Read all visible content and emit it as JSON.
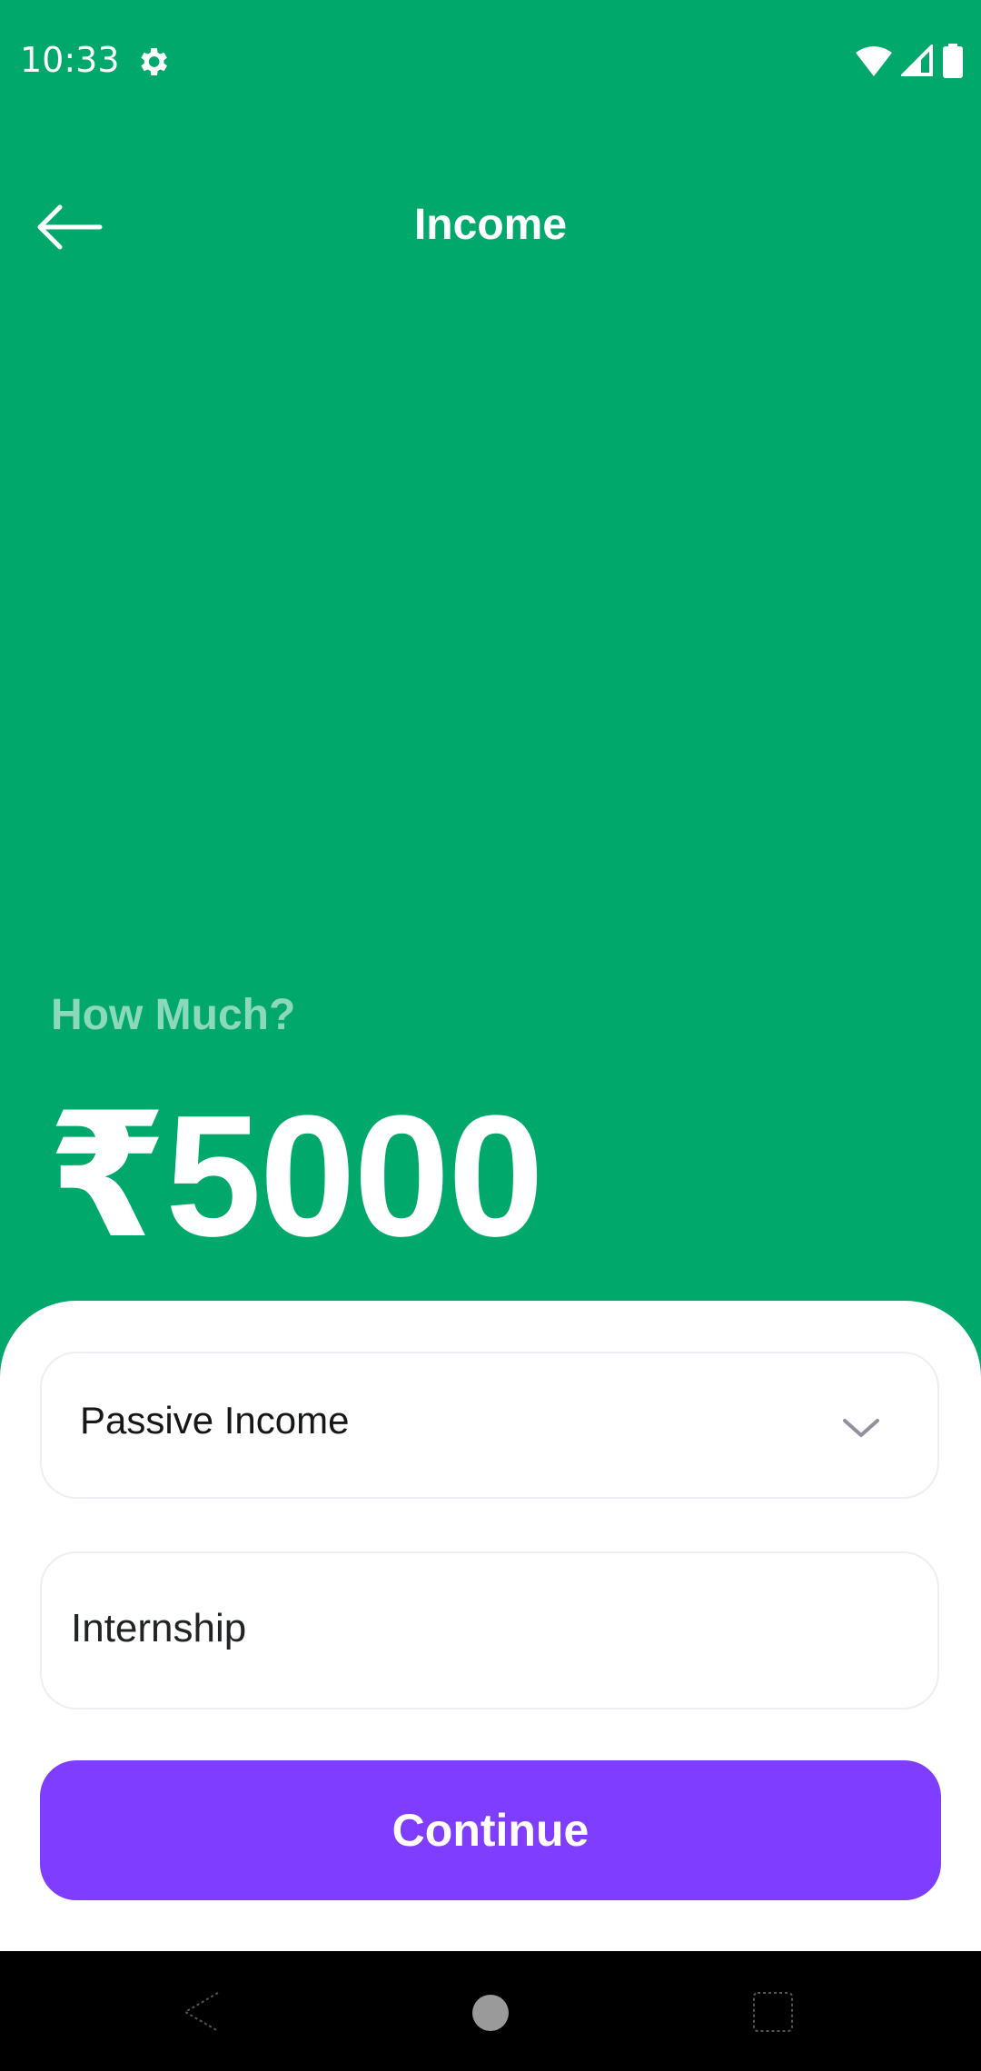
{
  "status_bar": {
    "time": "10:33"
  },
  "app_bar": {
    "title": "Income"
  },
  "amount_section": {
    "prompt": "How Much?",
    "amount": "₹5000"
  },
  "form": {
    "category_selected": "Passive Income",
    "description_value": "Internship",
    "continue_label": "Continue"
  },
  "colors": {
    "header_background": "#00A86B",
    "primary_button": "#7F3DFF",
    "sheet_background": "#FFFFFF"
  },
  "icons": {
    "status_settings": "gear-icon",
    "status_wifi": "wifi-icon",
    "status_signal": "signal-icon",
    "status_battery": "battery-icon",
    "back": "arrow-left-icon",
    "dropdown": "chevron-down-icon"
  }
}
